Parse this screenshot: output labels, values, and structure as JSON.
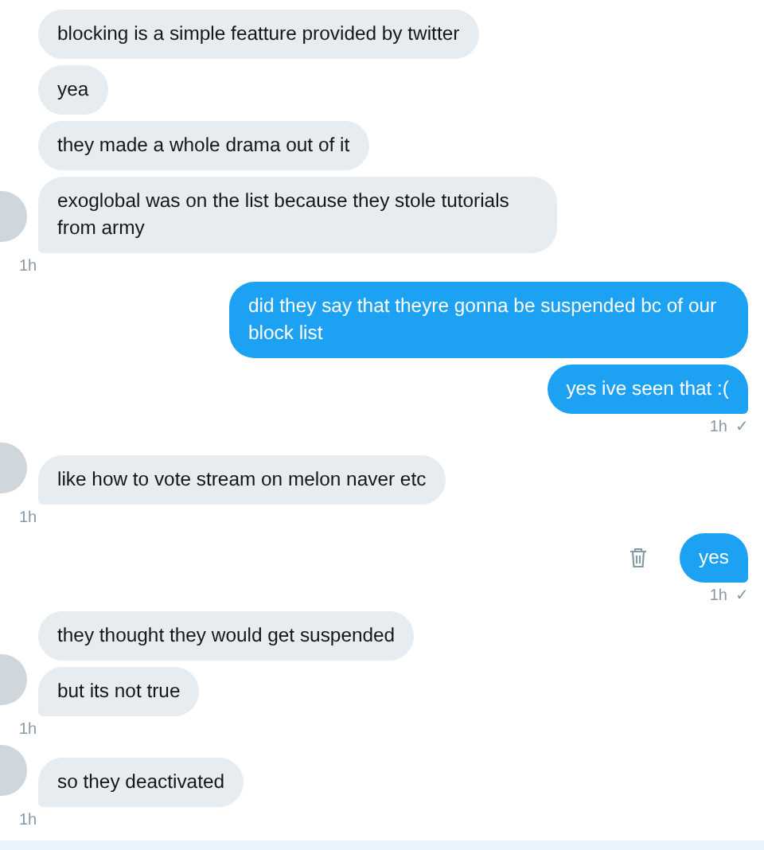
{
  "groups": [
    {
      "kind": "incoming",
      "messages": [
        "blocking is a simple featture provided by twitter",
        "yea",
        "they made a whole drama out of it",
        "exoglobal was on the list because they stole tutorials from army"
      ],
      "time": "1h"
    },
    {
      "kind": "outgoing",
      "messages": [
        "did they say that theyre gonna be suspended bc of our block list",
        "yes ive seen that :("
      ],
      "time": "1h",
      "status": "✓",
      "delete_shown": false
    },
    {
      "kind": "incoming",
      "messages": [
        "like how to vote stream on melon naver etc"
      ],
      "time": "1h"
    },
    {
      "kind": "outgoing",
      "messages": [
        "yes"
      ],
      "time": "1h",
      "status": "✓",
      "delete_shown": true
    },
    {
      "kind": "incoming",
      "messages": [
        "they thought they would get suspended",
        "but its not true"
      ],
      "time": "1h"
    },
    {
      "kind": "incoming",
      "messages": [
        "so they deactivated"
      ],
      "time": "1h"
    }
  ]
}
